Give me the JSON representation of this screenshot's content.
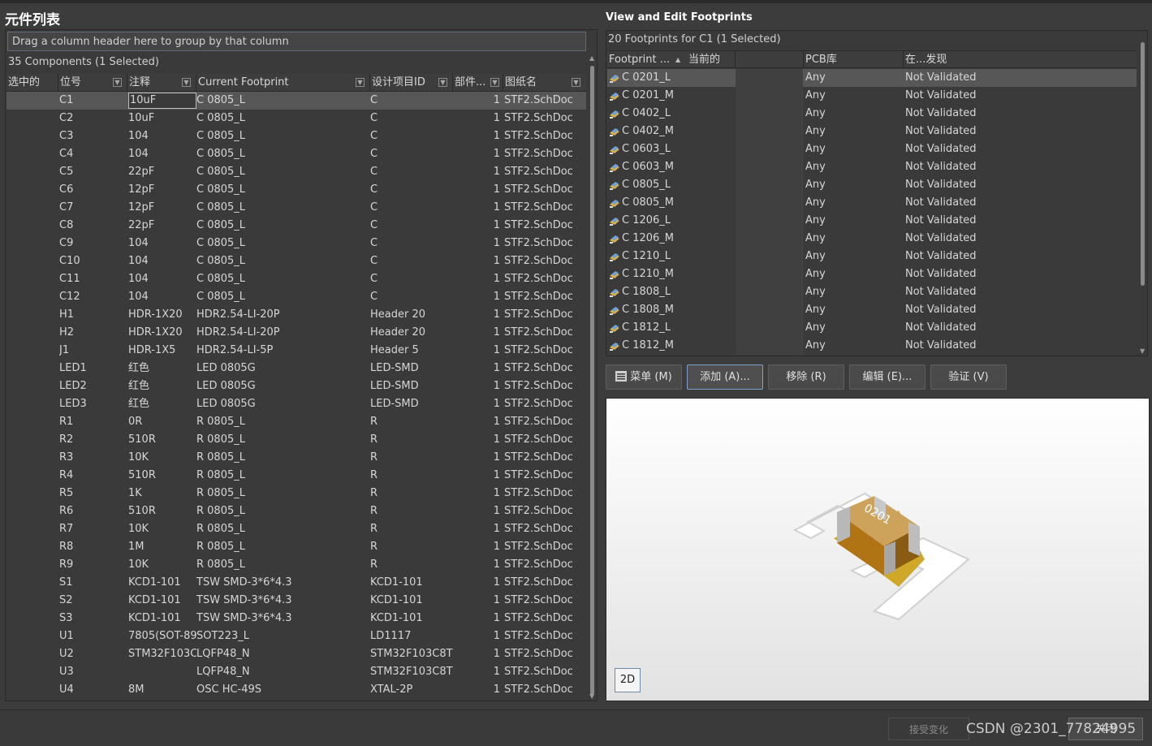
{
  "left": {
    "title": "元件列表",
    "group_hint": "Drag a column header here to group by that column",
    "status": "35 Components (1 Selected)",
    "columns": [
      "选中的",
      "位号",
      "注释",
      "Current Footprint",
      "设计项目ID",
      "部件...",
      "图纸名"
    ],
    "rows": [
      [
        "C1",
        "10uF",
        "C 0805_L",
        "C",
        "1",
        "STF2.SchDoc"
      ],
      [
        "C2",
        "10uF",
        "C 0805_L",
        "C",
        "1",
        "STF2.SchDoc"
      ],
      [
        "C3",
        "104",
        "C 0805_L",
        "C",
        "1",
        "STF2.SchDoc"
      ],
      [
        "C4",
        "104",
        "C 0805_L",
        "C",
        "1",
        "STF2.SchDoc"
      ],
      [
        "C5",
        "22pF",
        "C 0805_L",
        "C",
        "1",
        "STF2.SchDoc"
      ],
      [
        "C6",
        "12pF",
        "C 0805_L",
        "C",
        "1",
        "STF2.SchDoc"
      ],
      [
        "C7",
        "12pF",
        "C 0805_L",
        "C",
        "1",
        "STF2.SchDoc"
      ],
      [
        "C8",
        "22pF",
        "C 0805_L",
        "C",
        "1",
        "STF2.SchDoc"
      ],
      [
        "C9",
        "104",
        "C 0805_L",
        "C",
        "1",
        "STF2.SchDoc"
      ],
      [
        "C10",
        "104",
        "C 0805_L",
        "C",
        "1",
        "STF2.SchDoc"
      ],
      [
        "C11",
        "104",
        "C 0805_L",
        "C",
        "1",
        "STF2.SchDoc"
      ],
      [
        "C12",
        "104",
        "C 0805_L",
        "C",
        "1",
        "STF2.SchDoc"
      ],
      [
        "H1",
        "HDR-1X20",
        "HDR2.54-LI-20P",
        "Header 20",
        "1",
        "STF2.SchDoc"
      ],
      [
        "H2",
        "HDR-1X20",
        "HDR2.54-LI-20P",
        "Header 20",
        "1",
        "STF2.SchDoc"
      ],
      [
        "J1",
        "HDR-1X5",
        "HDR2.54-LI-5P",
        "Header 5",
        "1",
        "STF2.SchDoc"
      ],
      [
        "LED1",
        "红色",
        "LED 0805G",
        "LED-SMD",
        "1",
        "STF2.SchDoc"
      ],
      [
        "LED2",
        "红色",
        "LED 0805G",
        "LED-SMD",
        "1",
        "STF2.SchDoc"
      ],
      [
        "LED3",
        "红色",
        "LED 0805G",
        "LED-SMD",
        "1",
        "STF2.SchDoc"
      ],
      [
        "R1",
        "0R",
        "R 0805_L",
        "R",
        "1",
        "STF2.SchDoc"
      ],
      [
        "R2",
        "510R",
        "R 0805_L",
        "R",
        "1",
        "STF2.SchDoc"
      ],
      [
        "R3",
        "10K",
        "R 0805_L",
        "R",
        "1",
        "STF2.SchDoc"
      ],
      [
        "R4",
        "510R",
        "R 0805_L",
        "R",
        "1",
        "STF2.SchDoc"
      ],
      [
        "R5",
        "1K",
        "R 0805_L",
        "R",
        "1",
        "STF2.SchDoc"
      ],
      [
        "R6",
        "510R",
        "R 0805_L",
        "R",
        "1",
        "STF2.SchDoc"
      ],
      [
        "R7",
        "10K",
        "R 0805_L",
        "R",
        "1",
        "STF2.SchDoc"
      ],
      [
        "R8",
        "1M",
        "R 0805_L",
        "R",
        "1",
        "STF2.SchDoc"
      ],
      [
        "R9",
        "10K",
        "R 0805_L",
        "R",
        "1",
        "STF2.SchDoc"
      ],
      [
        "S1",
        "KCD1-101",
        "TSW SMD-3*6*4.3",
        "KCD1-101",
        "1",
        "STF2.SchDoc"
      ],
      [
        "S2",
        "KCD1-101",
        "TSW SMD-3*6*4.3",
        "KCD1-101",
        "1",
        "STF2.SchDoc"
      ],
      [
        "S3",
        "KCD1-101",
        "TSW SMD-3*6*4.3",
        "KCD1-101",
        "1",
        "STF2.SchDoc"
      ],
      [
        "U1",
        "7805(SOT-89",
        "SOT223_L",
        "LD1117",
        "1",
        "STF2.SchDoc"
      ],
      [
        "U2",
        "STM32F103C",
        "LQFP48_N",
        "STM32F103C8T6",
        "1",
        "STF2.SchDoc"
      ],
      [
        "U3",
        "",
        "LQFP48_N",
        "STM32F103C8T6",
        "1",
        "STF2.SchDoc"
      ],
      [
        "U4",
        "8M",
        "OSC HC-49S",
        "XTAL-2P",
        "1",
        "STF2.SchDoc"
      ]
    ]
  },
  "right": {
    "title": "View and Edit Footprints",
    "status": "20 Footprints for C1 (1 Selected)",
    "columns": [
      "Footprint ...",
      "当前的",
      "PCB库",
      "在...发现"
    ],
    "rows": [
      [
        "C 0201_L",
        "Any",
        "Not Validated"
      ],
      [
        "C 0201_M",
        "Any",
        "Not Validated"
      ],
      [
        "C 0402_L",
        "Any",
        "Not Validated"
      ],
      [
        "C 0402_M",
        "Any",
        "Not Validated"
      ],
      [
        "C 0603_L",
        "Any",
        "Not Validated"
      ],
      [
        "C 0603_M",
        "Any",
        "Not Validated"
      ],
      [
        "C 0805_L",
        "Any",
        "Not Validated"
      ],
      [
        "C 0805_M",
        "Any",
        "Not Validated"
      ],
      [
        "C 1206_L",
        "Any",
        "Not Validated"
      ],
      [
        "C 1206_M",
        "Any",
        "Not Validated"
      ],
      [
        "C 1210_L",
        "Any",
        "Not Validated"
      ],
      [
        "C 1210_M",
        "Any",
        "Not Validated"
      ],
      [
        "C 1808_L",
        "Any",
        "Not Validated"
      ],
      [
        "C 1808_M",
        "Any",
        "Not Validated"
      ],
      [
        "C 1812_L",
        "Any",
        "Not Validated"
      ],
      [
        "C 1812_M",
        "Any",
        "Not Validated"
      ]
    ],
    "buttons": {
      "menu": "菜单 (M)",
      "add": "添加 (A)...",
      "remove": "移除 (R)",
      "edit": "编辑 (E)...",
      "validate": "验证 (V)"
    },
    "preview": {
      "chip_label": "0201",
      "view_mode": "2D"
    }
  },
  "bottom": {
    "accept": "接受变化",
    "close": "关闭",
    "watermark": "CSDN @2301_77824995"
  },
  "icons": {
    "footprint": "footprint-icon",
    "filter": "filter-icon",
    "sort": "sort-asc-icon",
    "menu": "menu-icon"
  }
}
